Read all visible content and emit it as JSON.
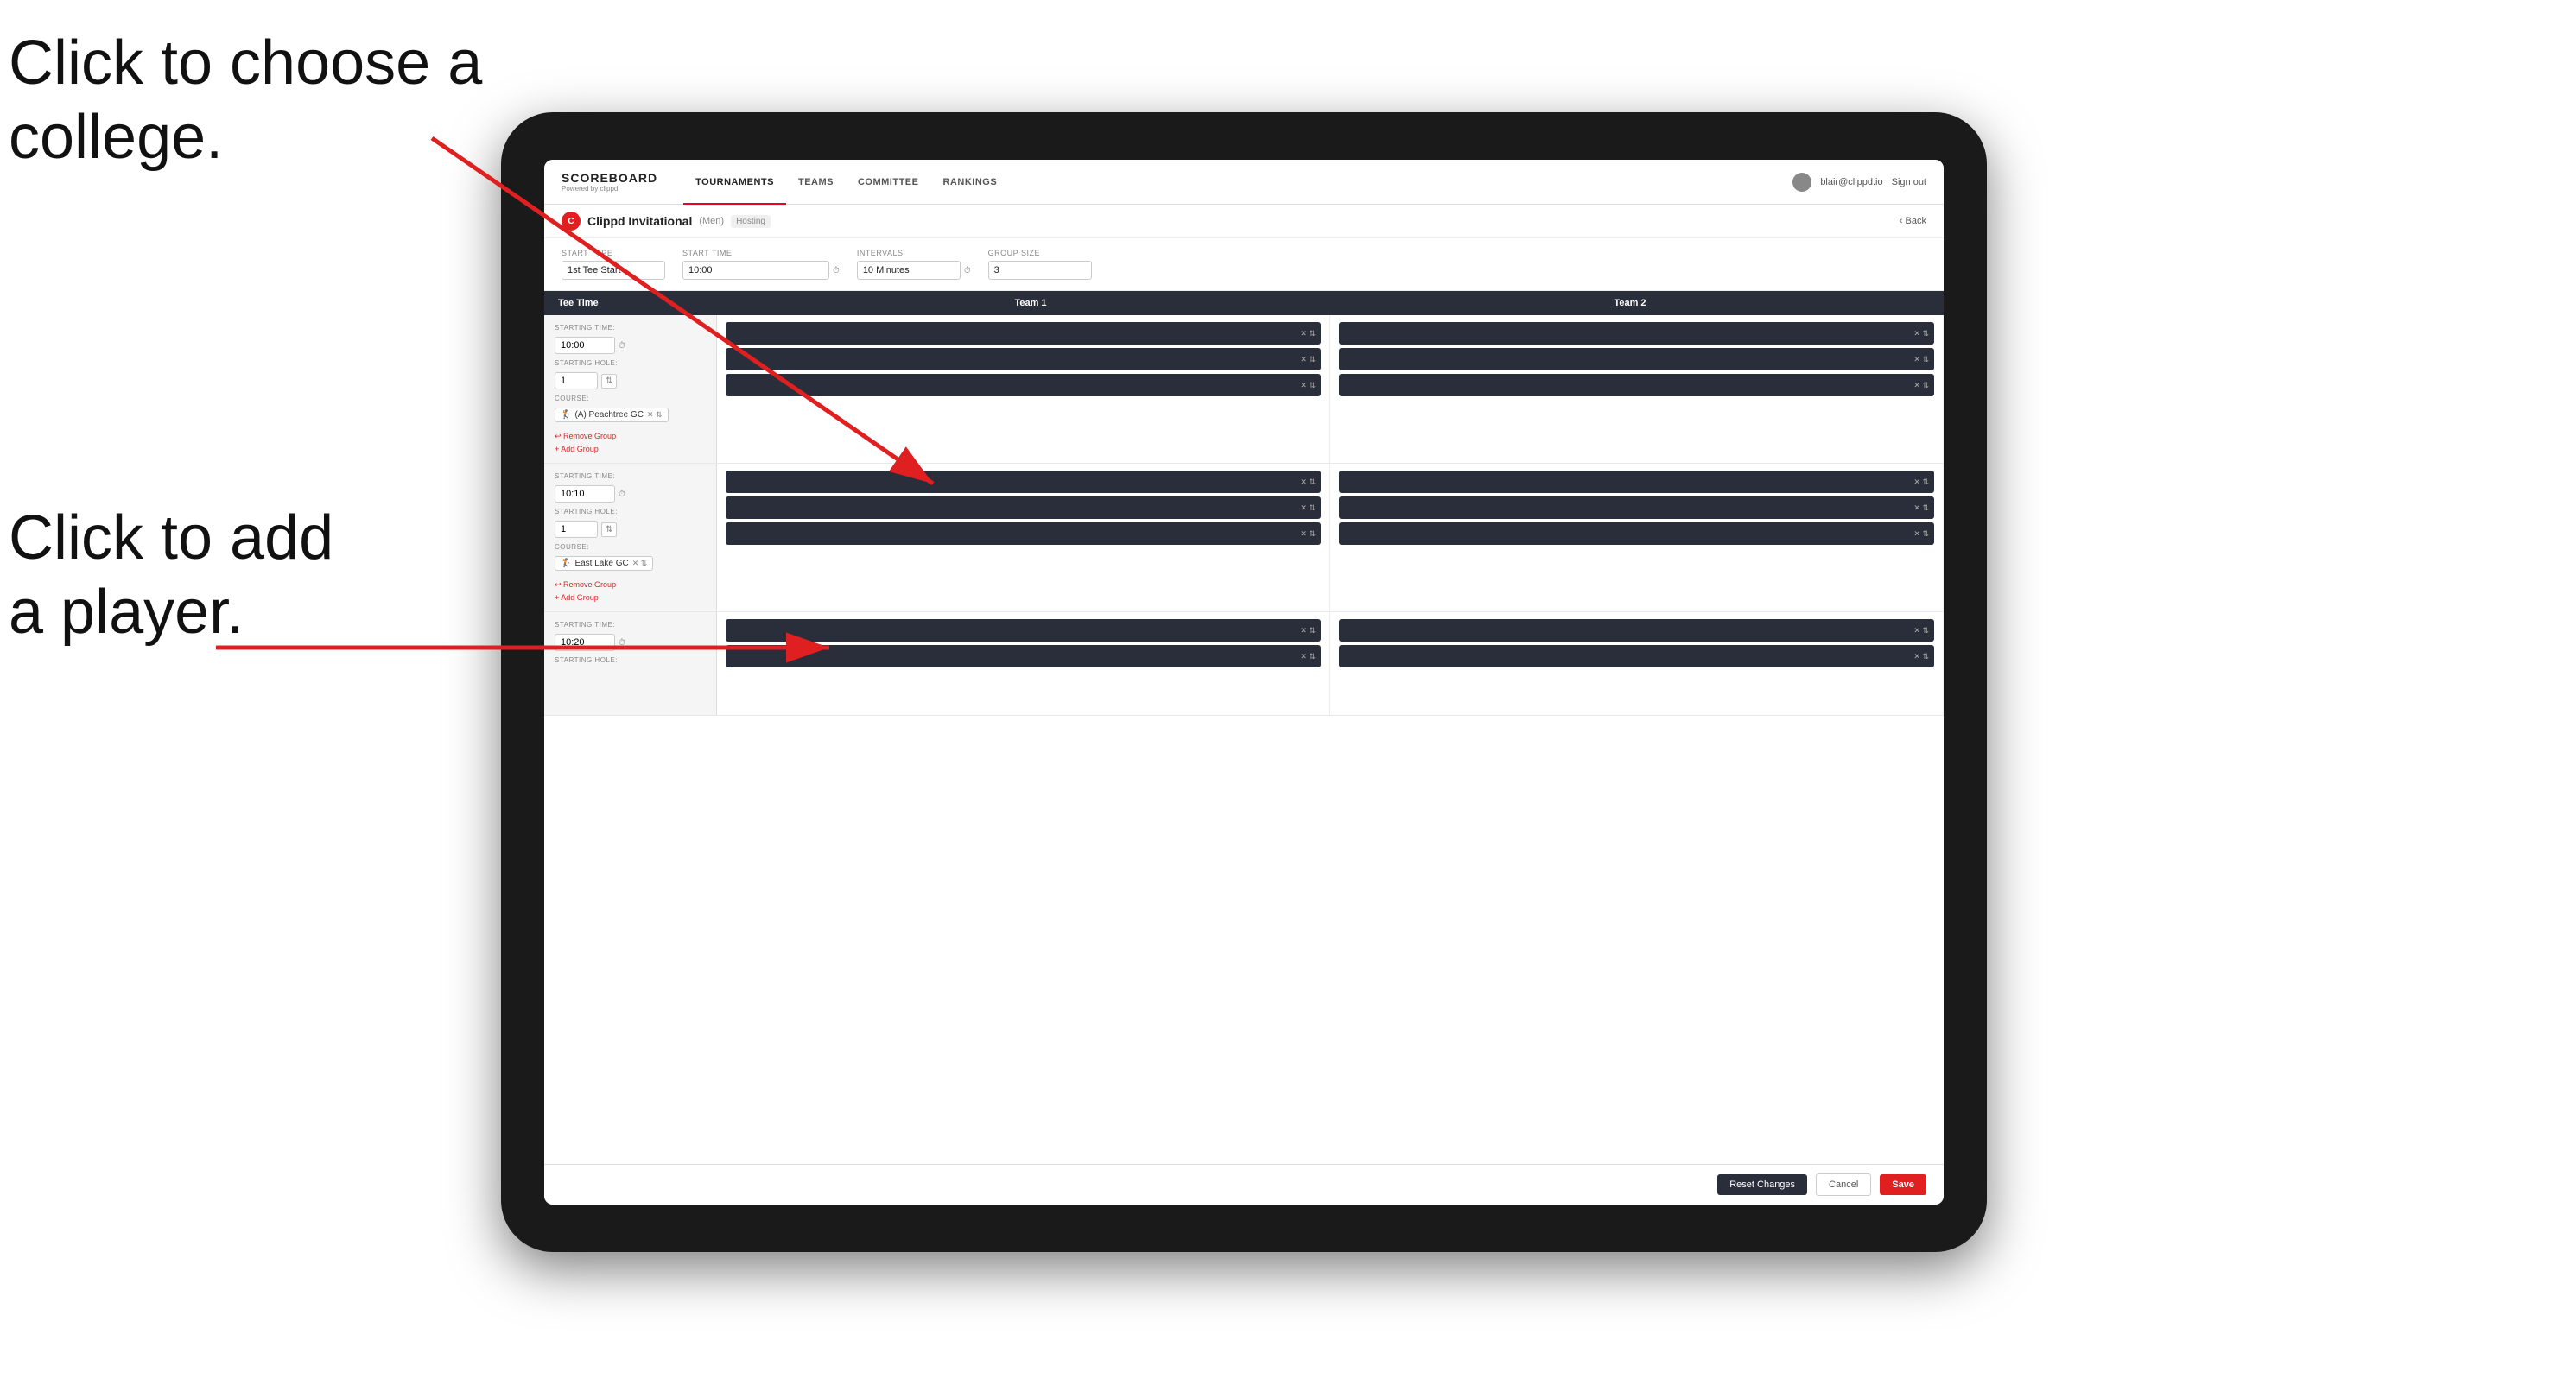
{
  "annotations": {
    "college": "Click to choose a\ncollege.",
    "player": "Click to add\na player."
  },
  "nav": {
    "brand": "SCOREBOARD",
    "brand_sub": "Powered by clippd",
    "links": [
      "TOURNAMENTS",
      "TEAMS",
      "COMMITTEE",
      "RANKINGS"
    ],
    "active_link": "TOURNAMENTS",
    "user_email": "blair@clippd.io",
    "sign_out": "Sign out"
  },
  "sub_header": {
    "tournament_name": "Clippd Invitational",
    "gender": "(Men)",
    "hosting": "Hosting",
    "back_label": "Back"
  },
  "form": {
    "start_type_label": "Start Type",
    "start_type_value": "1st Tee Start",
    "start_time_label": "Start Time",
    "start_time_value": "10:00",
    "intervals_label": "Intervals",
    "intervals_value": "10 Minutes",
    "group_size_label": "Group Size",
    "group_size_value": "3"
  },
  "table": {
    "tee_time_col": "Tee Time",
    "team1_col": "Team 1",
    "team2_col": "Team 2"
  },
  "groups": [
    {
      "id": 1,
      "starting_time": "10:00",
      "starting_hole": "1",
      "course": "(A) Peachtree GC",
      "team1_slots": 3,
      "team2_slots": 3,
      "actions": [
        "Remove Group",
        "Add Group"
      ]
    },
    {
      "id": 2,
      "starting_time": "10:10",
      "starting_hole": "1",
      "course": "East Lake GC",
      "team1_slots": 3,
      "team2_slots": 3,
      "actions": [
        "Remove Group",
        "Add Group"
      ]
    },
    {
      "id": 3,
      "starting_time": "10:20",
      "starting_hole": "",
      "course": "",
      "team1_slots": 2,
      "team2_slots": 2,
      "actions": []
    }
  ],
  "buttons": {
    "reset": "Reset Changes",
    "cancel": "Cancel",
    "save": "Save"
  }
}
